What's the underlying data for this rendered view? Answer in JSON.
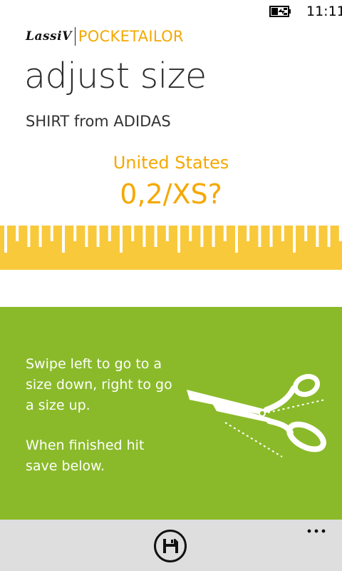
{
  "status_bar": {
    "time": "11:11",
    "battery_icon": "battery-charging-icon"
  },
  "header": {
    "brand_logo": "LassiV",
    "app_name": "POCKETAILOR"
  },
  "page": {
    "title": "adjust size",
    "product": "SHIRT from ADIDAS"
  },
  "size": {
    "region": "United States",
    "value": "0,2/XS?"
  },
  "instructions": {
    "line1": "Swipe left to go to a size down, right to go a size up.",
    "line2": "When finished hit save below.",
    "icon": "scissors-icon"
  },
  "app_bar": {
    "save_icon": "save-icon",
    "more_icon": "more-icon"
  },
  "colors": {
    "accent": "#f5a800",
    "ruler": "#f9c93c",
    "panel": "#8aba2a",
    "app_bar": "#dedede"
  }
}
